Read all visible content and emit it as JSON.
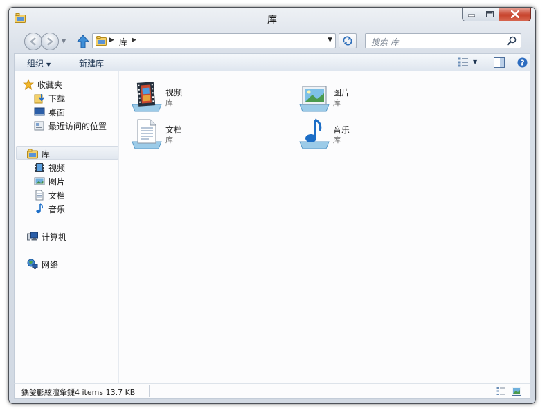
{
  "window": {
    "title": "库"
  },
  "address": {
    "crumb": "库",
    "search_placeholder": "搜索 库"
  },
  "commands": {
    "organize": "组织",
    "new_library": "新建库"
  },
  "nav": {
    "favorites": "收藏夹",
    "downloads": "下载",
    "desktop": "桌面",
    "recent": "最近访问的位置",
    "libraries": "库",
    "videos": "视频",
    "pictures": "图片",
    "documents": "文档",
    "music": "音乐",
    "computer": "计算机",
    "network": "网络"
  },
  "libraries": [
    {
      "name": "视频",
      "type": "库",
      "icon": "video-library-icon"
    },
    {
      "name": "图片",
      "type": "库",
      "icon": "picture-library-icon"
    },
    {
      "name": "文档",
      "type": "库",
      "icon": "document-library-icon"
    },
    {
      "name": "音乐",
      "type": "库",
      "icon": "music-library-icon"
    }
  ],
  "status": {
    "text": "鍝夎彲絃澶夆鏁4 items 13.7 KB"
  },
  "colors": {
    "accent": "#1e3552",
    "selection": "#e1e7ef",
    "close_button": "#c7432c"
  }
}
